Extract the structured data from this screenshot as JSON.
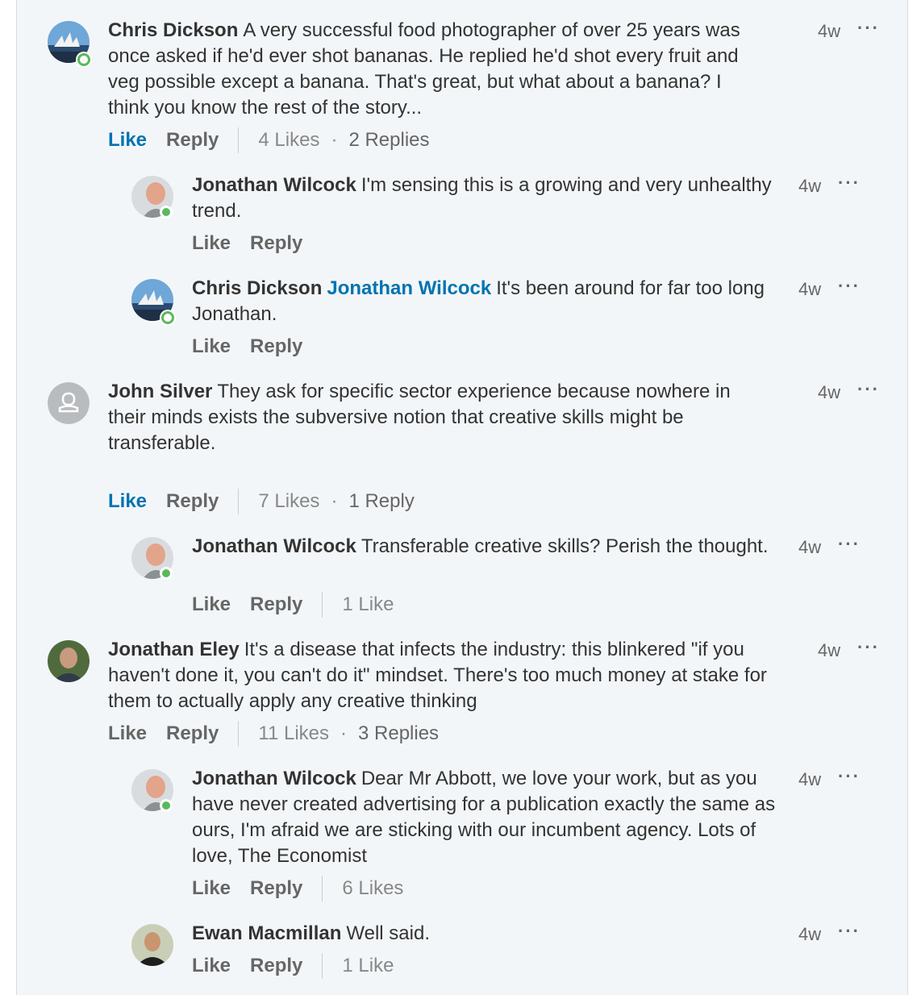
{
  "colors": {
    "accent": "#0073b1",
    "presence": "#5cb85c",
    "panel": "#f3f6f8"
  },
  "comments": [
    {
      "author": "Chris Dickson",
      "text": "A very successful food photographer of over 25 years was once asked if he'd ever shot bananas. He replied he'd shot every fruit and veg possible except a banana. That's great, but what about a banana? I think you know the rest of the story...",
      "time": "4w",
      "more": "···",
      "like": "Like",
      "reply": "Reply",
      "likes": "4 Likes",
      "replies": "2 Replies",
      "replies_list": [
        {
          "author": "Jonathan Wilcock",
          "text": "I'm sensing this is a growing and very unhealthy trend.",
          "time": "4w",
          "more": "···",
          "like": "Like",
          "reply": "Reply"
        },
        {
          "author": "Chris Dickson",
          "mention": "Jonathan Wilcock",
          "text": "It's been around for far too long Jonathan.",
          "time": "4w",
          "more": "···",
          "like": "Like",
          "reply": "Reply"
        }
      ]
    },
    {
      "author": "John Silver",
      "text": "They ask for specific sector experience because nowhere in their minds exists the subversive notion that creative skills might be transferable.",
      "time": "4w",
      "more": "···",
      "like": "Like",
      "reply": "Reply",
      "likes": "7 Likes",
      "replies": "1 Reply",
      "replies_list": [
        {
          "author": "Jonathan Wilcock",
          "text": "Transferable creative skills? Perish the thought.",
          "time": "4w",
          "more": "···",
          "like": "Like",
          "reply": "Reply",
          "likes": "1 Like"
        }
      ]
    },
    {
      "author": "Jonathan Eley",
      "text": "It's a disease that infects the industry: this blinkered \"if you haven't done it, you can't do it\" mindset. There's too much money at stake for them to actually apply any creative thinking",
      "time": "4w",
      "more": "···",
      "like": "Like",
      "reply": "Reply",
      "likes": "11 Likes",
      "replies": "3 Replies",
      "replies_list": [
        {
          "author": "Jonathan Wilcock",
          "text": "Dear Mr Abbott, we love your work, but as you have never created advertising for a publication exactly the same as ours, I'm afraid we are sticking with our incumbent agency. Lots of love, The Economist",
          "time": "4w",
          "more": "···",
          "like": "Like",
          "reply": "Reply",
          "likes": "6 Likes"
        },
        {
          "author": "Ewan Macmillan",
          "text": "Well said.",
          "time": "4w",
          "more": "···",
          "like": "Like",
          "reply": "Reply",
          "likes": "1 Like"
        }
      ]
    }
  ]
}
